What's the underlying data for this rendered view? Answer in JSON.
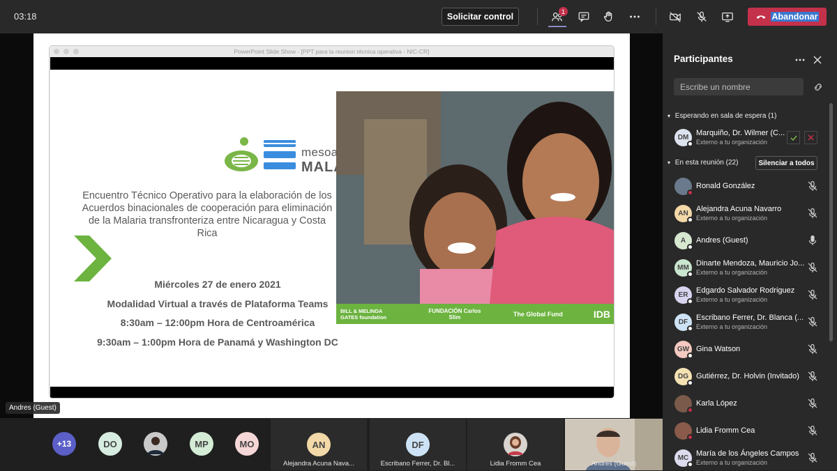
{
  "topbar": {
    "timer": "03:18",
    "request_control": "Solicitar control",
    "participants_badge": "1",
    "leave_label": "Abandonar"
  },
  "presentation": {
    "window_title": "PowerPoint Slide Show - [PPT para la reunion técnica operativa - NIC-CR]",
    "logo_line1": "mesoamerica",
    "logo_line2": "MALARIA",
    "title": "Encuentro Técnico Operativo para la elaboración de los Acuerdos binacionales de cooperación para eliminación de la Malaria transfronteriza entre Nicaragua y Costa Rica",
    "date": "Miércoles 27 de enero 2021",
    "modality": "Modalidad Virtual a través de Plataforma Teams",
    "time1": "8:30am – 12:00pm Hora de Centroamérica",
    "time2": "9:30am – 1:00pm Hora de Panamá y Washington DC",
    "sponsors": [
      "BILL & MELINDA GATES foundation",
      "FUNDACIÓN Carlos Slim",
      "The Global Fund",
      "IDB"
    ],
    "presenter_label": "Andres (Guest)"
  },
  "strip": {
    "overflow": "+13",
    "avatars": [
      "DO",
      "MP",
      "MO"
    ],
    "tiles": [
      {
        "initials": "AN",
        "name": "Alejandra Acuna Nava..."
      },
      {
        "initials": "DF",
        "name": "Escribano Ferrer, Dr. Bl..."
      },
      {
        "initials": "",
        "name": "Lidia Fromm Cea"
      },
      {
        "initials": "",
        "name": "Andres (Guest)"
      }
    ]
  },
  "panel": {
    "title": "Participantes",
    "search_placeholder": "Escribe un nombre",
    "lobby_header": "Esperando en sala de espera (1)",
    "meeting_header": "En esta reunión (22)",
    "mute_all": "Silenciar a todos",
    "lobby": {
      "initials": "DM",
      "name": "Marquiño, Dr. Wilmer (C...",
      "sub": "Externo a tu organización"
    },
    "people": [
      {
        "initials": "",
        "name": "Ronald González",
        "sub": "",
        "color": "#6a7a8c"
      },
      {
        "initials": "AN",
        "name": "Alejandra Acuna Navarro",
        "sub": "Externo a tu organización",
        "color": "#f3d9a8"
      },
      {
        "initials": "A",
        "name": "Andres (Guest)",
        "sub": "",
        "color": "#d6e8d0"
      },
      {
        "initials": "MM",
        "name": "Dinarte Mendoza, Mauricio Jo...",
        "sub": "Externo a tu organización",
        "color": "#c9e6cf"
      },
      {
        "initials": "ER",
        "name": "Edgardo Salvador Rodriguez",
        "sub": "Externo a tu organización",
        "color": "#d8d4f0"
      },
      {
        "initials": "DF",
        "name": "Escribano Ferrer, Dr. Blanca (...",
        "sub": "Externo a tu organización",
        "color": "#cde3f5"
      },
      {
        "initials": "GW",
        "name": "Gina Watson",
        "sub": "",
        "color": "#f4c9c0"
      },
      {
        "initials": "DG",
        "name": "Gutiérrez, Dr. Holvin (Invitado)",
        "sub": "",
        "color": "#f5e2b3"
      },
      {
        "initials": "",
        "name": "Karla López",
        "sub": "",
        "color": "#7a5a4a"
      },
      {
        "initials": "",
        "name": "Lidia Fromm Cea",
        "sub": "",
        "color": "#8a5a4a"
      },
      {
        "initials": "MC",
        "name": "María de los Ángeles Campos",
        "sub": "Externo a tu organización",
        "color": "#dcdcee"
      }
    ]
  }
}
